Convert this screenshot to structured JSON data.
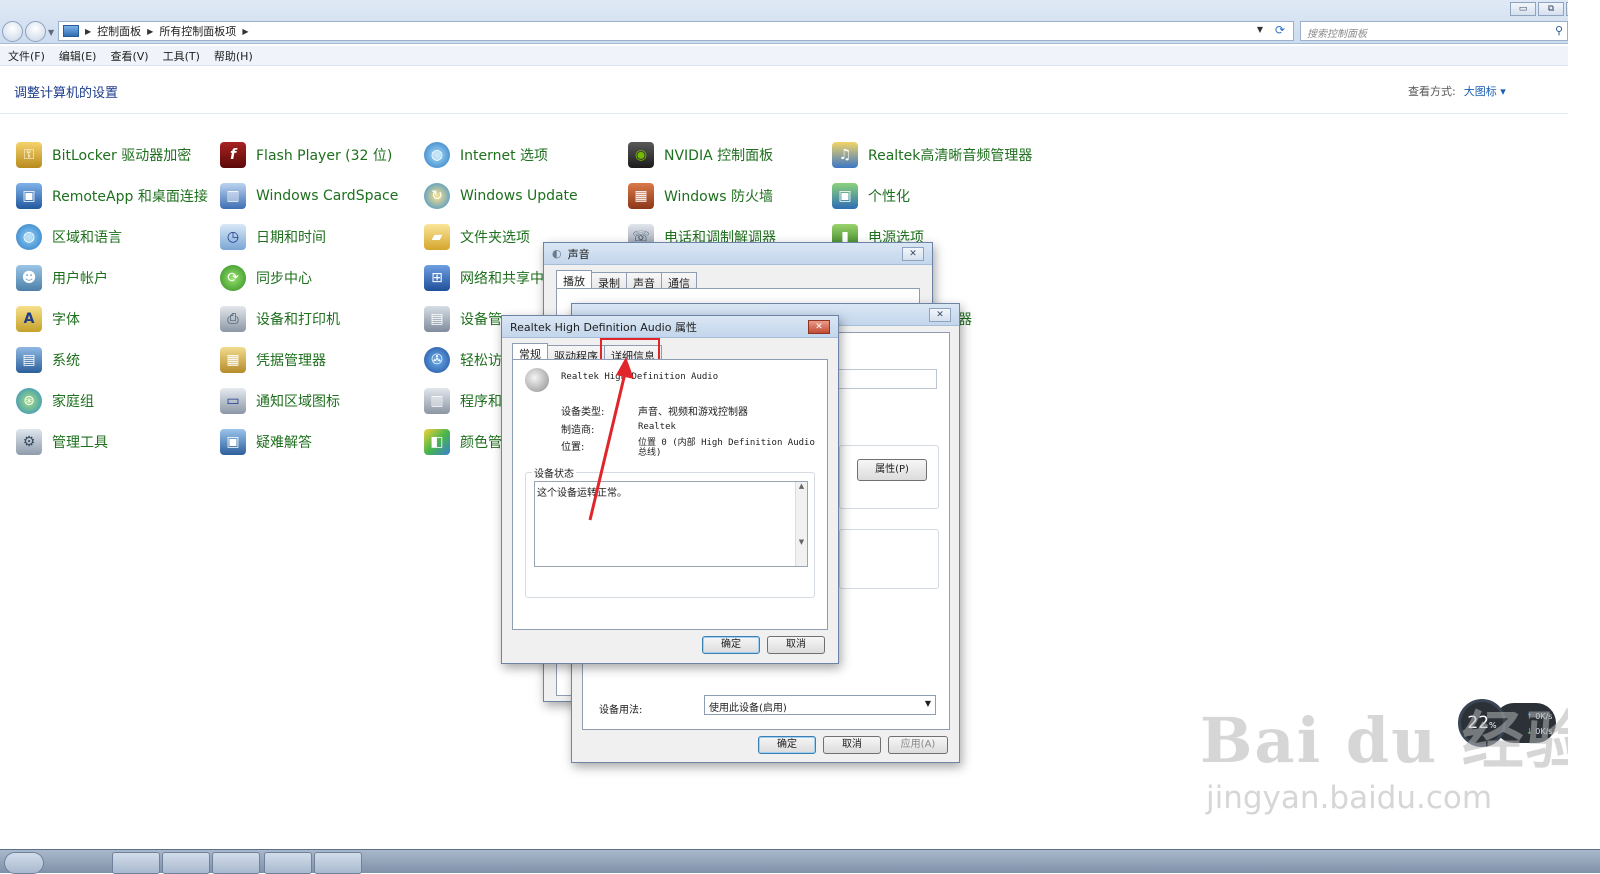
{
  "window": {
    "minimize": "▭",
    "restore": "⧉",
    "close": "✕"
  },
  "address": {
    "crumbs": [
      "控制面板",
      "所有控制面板项"
    ],
    "search_placeholder": "搜索控制面板"
  },
  "menu": [
    "文件(F)",
    "编辑(E)",
    "查看(V)",
    "工具(T)",
    "帮助(H)"
  ],
  "page": {
    "title": "调整计算机的设置",
    "view_by_label": "查看方式:",
    "view_by_value": "大图标 ▾"
  },
  "items": {
    "c1": [
      "BitLocker 驱动器加密",
      "RemoteApp 和桌面连接",
      "区域和语言",
      "用户帐户",
      "字体",
      "系统",
      "家庭组",
      "管理工具"
    ],
    "c2": [
      "Flash Player (32 位)",
      "Windows CardSpace",
      "日期和时间",
      "同步中心",
      "设备和打印机",
      "凭据管理器",
      "通知区域图标",
      "疑难解答"
    ],
    "c3": [
      "Internet 选项",
      "Windows Update",
      "文件夹选项",
      "网络和共享中心",
      "设备管",
      "轻松访",
      "程序和",
      "颜色管"
    ],
    "c4": [
      "NVIDIA 控制面板",
      "Windows 防火墙",
      "电话和调制解调器"
    ],
    "c5": [
      "Realtek高清晰音频管理器",
      "个性化",
      "电源选项"
    ],
    "c5_partial": "器"
  },
  "sound_dialog": {
    "title": "声音",
    "tabs": [
      "播放",
      "录制",
      "声音",
      "通信"
    ]
  },
  "speaker_props": {
    "properties_button": "属性(P)",
    "usage_label": "设备用法:",
    "usage_value": "使用此设备(启用)",
    "ok": "确定",
    "cancel": "取消",
    "apply": "应用(A)"
  },
  "realtek_dialog": {
    "title": "Realtek High Definition Audio 属性",
    "tabs": [
      "常规",
      "驱动程序",
      "详细信息"
    ],
    "device_name": "Realtek High Definition Audio",
    "type_label": "设备类型:",
    "type_value": "声音、视频和游戏控制器",
    "mfr_label": "制造商:",
    "mfr_value": "Realtek",
    "loc_label": "位置:",
    "loc_value": "位置 0 (内部 High Definition Audio 总线)",
    "status_label": "设备状态",
    "status_text": "这个设备运转正常。",
    "ok": "确定",
    "cancel": "取消"
  },
  "widget": {
    "percent": "22",
    "unit": "%",
    "up": "0K/s",
    "down": "0K/s"
  },
  "watermark": {
    "brand": "Bai du 经验",
    "url": "jingyan.baidu.com"
  },
  "colors": {
    "link_green": "#1e6f1e",
    "title_blue": "#1d3c8a",
    "highlight_red": "#e0262a"
  }
}
